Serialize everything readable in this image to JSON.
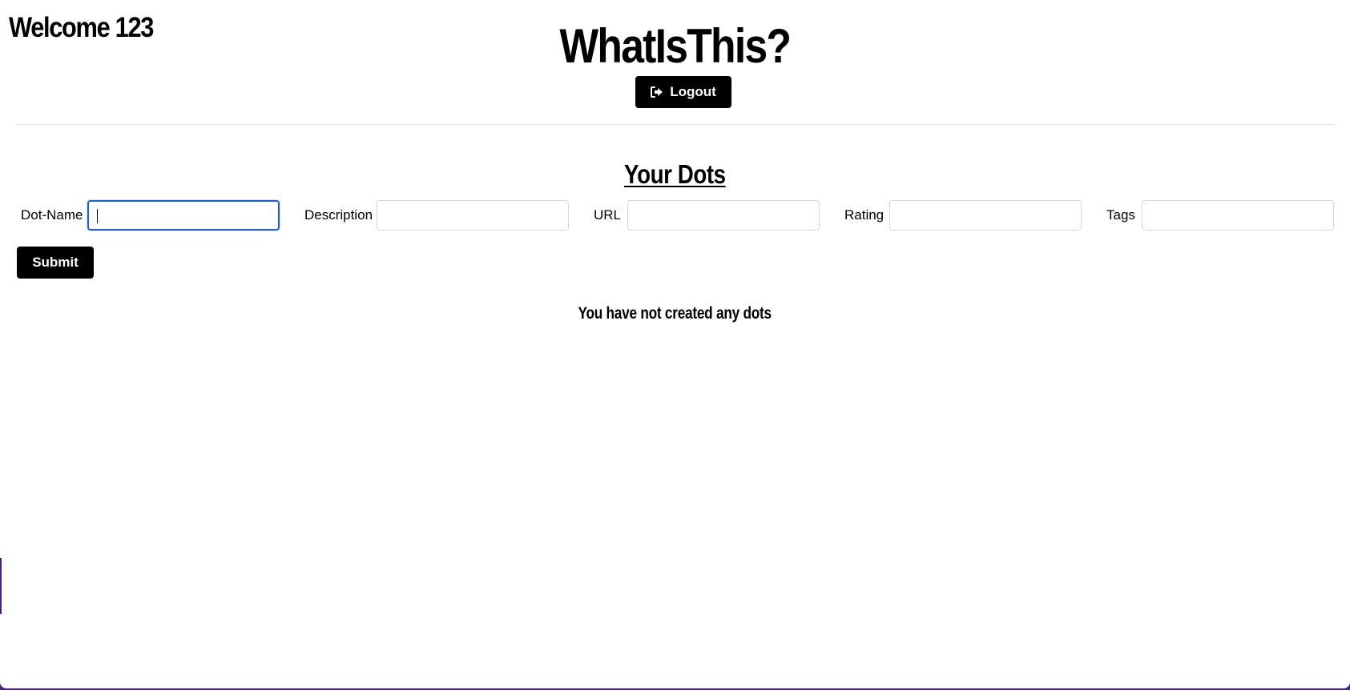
{
  "header": {
    "welcome_text": "Welcome 123",
    "app_title": "WhatIsThis?",
    "logout_label": "Logout",
    "logout_icon": "sign-out-icon"
  },
  "main": {
    "section_title": "Your Dots",
    "form": {
      "fields": [
        {
          "label": "Dot-Name",
          "value": "",
          "placeholder": ""
        },
        {
          "label": "Description",
          "value": "",
          "placeholder": ""
        },
        {
          "label": "URL",
          "value": "",
          "placeholder": ""
        },
        {
          "label": "Rating",
          "value": "",
          "placeholder": ""
        },
        {
          "label": "Tags",
          "value": "",
          "placeholder": ""
        }
      ],
      "submit_label": "Submit"
    },
    "empty_message": "You have not created any dots"
  },
  "colors": {
    "focus_border": "#1a5fd1",
    "button_bg": "#000000",
    "window_backdrop": "#4a1e8c"
  }
}
